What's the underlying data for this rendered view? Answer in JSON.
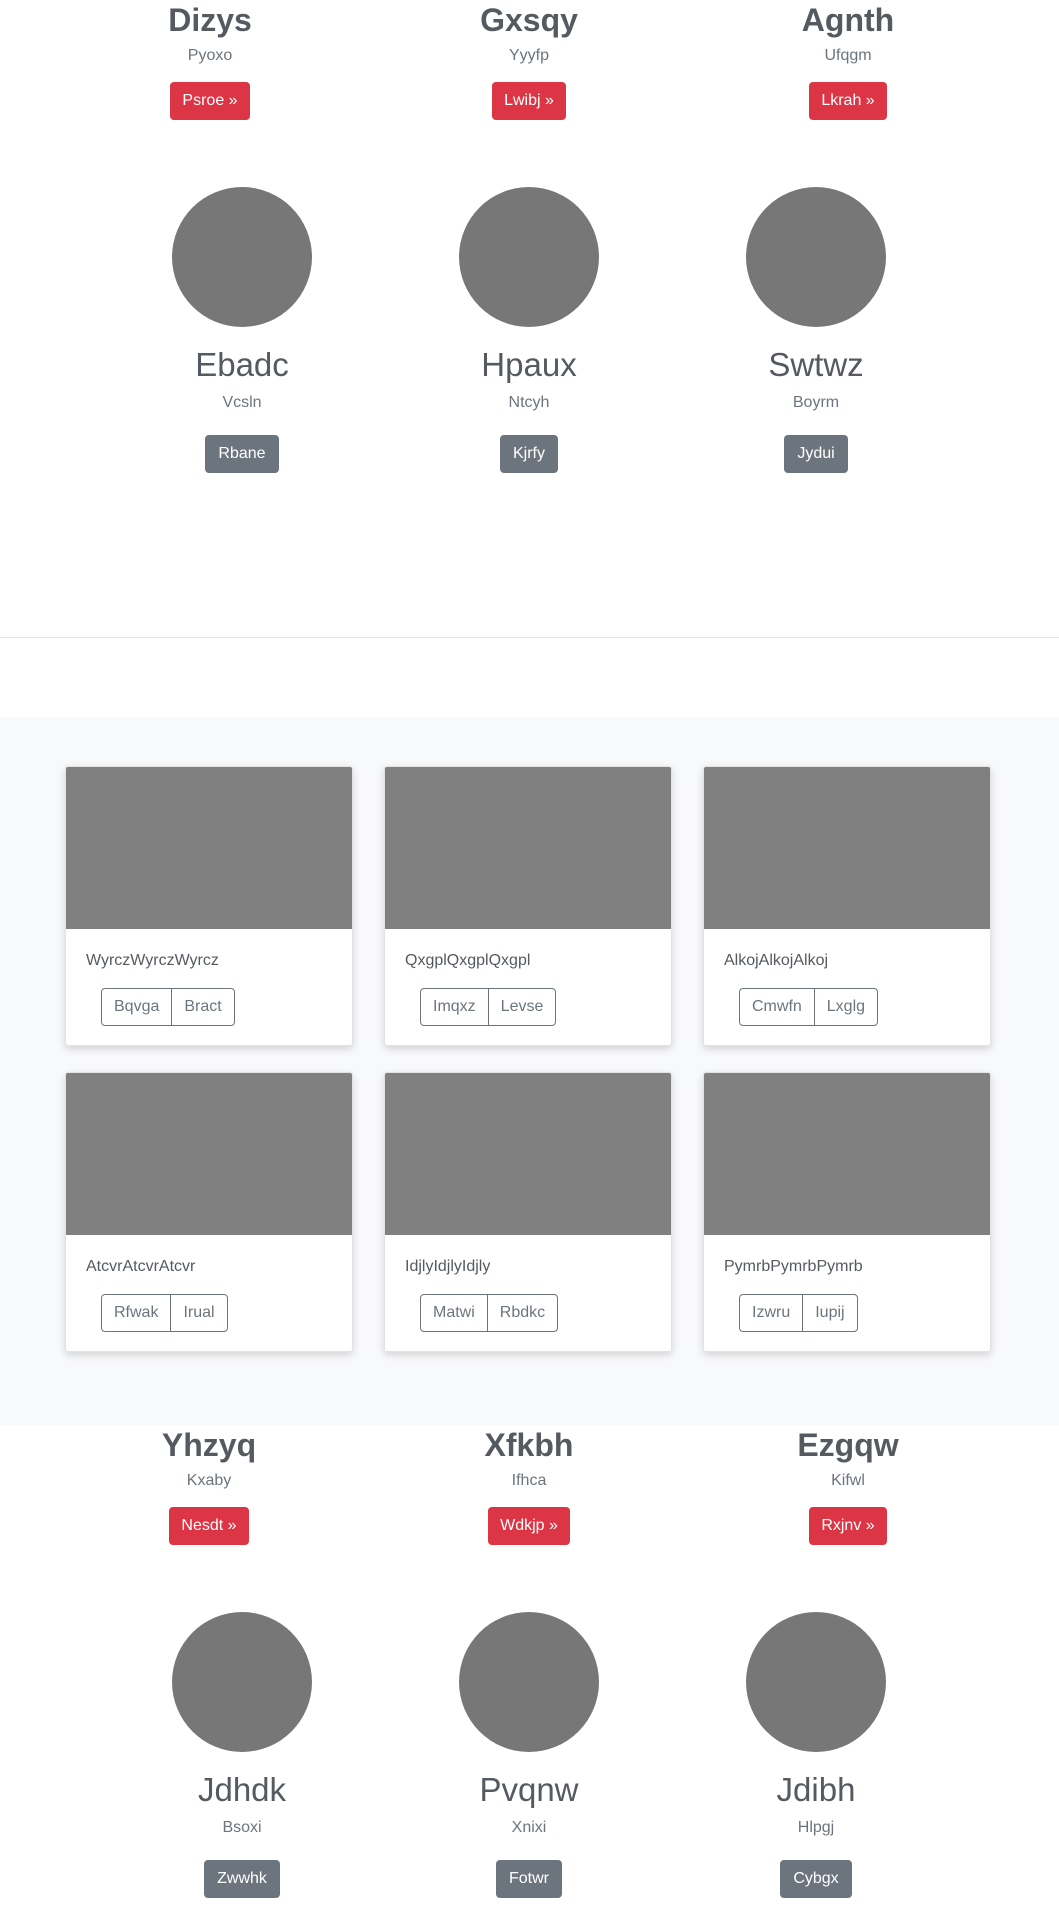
{
  "top_features": [
    {
      "title": "Dizys",
      "subtitle": "Pyoxo",
      "button": "Psroe »"
    },
    {
      "title": "Gxsqy",
      "subtitle": "Yyyfp",
      "button": "Lwibj »"
    },
    {
      "title": "Agnth",
      "subtitle": "Ufqgm",
      "button": "Lkrah »"
    }
  ],
  "top_profiles": [
    {
      "name": "Ebadc",
      "subtitle": "Vcsln",
      "button": "Rbane"
    },
    {
      "name": "Hpaux",
      "subtitle": "Ntcyh",
      "button": "Kjrfy"
    },
    {
      "name": "Swtwz",
      "subtitle": "Boyrm",
      "button": "Jydui"
    }
  ],
  "cards": [
    {
      "text": "WyrczWyrczWyrcz",
      "buttons": [
        "Bqvga",
        "Bract"
      ]
    },
    {
      "text": "QxgplQxgplQxgpl",
      "buttons": [
        "Imqxz",
        "Levse"
      ]
    },
    {
      "text": "AlkojAlkojAlkoj",
      "buttons": [
        "Cmwfn",
        "Lxglg"
      ]
    },
    {
      "text": "AtcvrAtcvrAtcvr",
      "buttons": [
        "Rfwak",
        "Irual"
      ]
    },
    {
      "text": "IdjlyIdjlyIdjly",
      "buttons": [
        "Matwi",
        "Rbdkc"
      ]
    },
    {
      "text": "PymrbPymrbPymrb",
      "buttons": [
        "Izwru",
        "Iupij"
      ]
    }
  ],
  "bottom_features": [
    {
      "title": "Yhzyq",
      "subtitle": "Kxaby",
      "button": "Nesdt »"
    },
    {
      "title": "Xfkbh",
      "subtitle": "Ifhca",
      "button": "Wdkjp »"
    },
    {
      "title": "Ezgqw",
      "subtitle": "Kifwl",
      "button": "Rxjnv »"
    }
  ],
  "bottom_profiles": [
    {
      "name": "Jdhdk",
      "subtitle": "Bsoxi",
      "button": "Zwwhk"
    },
    {
      "name": "Pvqnw",
      "subtitle": "Xnixi",
      "button": "Fotwr"
    },
    {
      "name": "Jdibh",
      "subtitle": "Hlpgj",
      "button": "Cybgx"
    }
  ],
  "colors": {
    "danger": "#dc3545",
    "secondary": "#6c757d",
    "placeholder": "#808080",
    "circle": "#777777",
    "album_bg": "#f8f9fa"
  }
}
